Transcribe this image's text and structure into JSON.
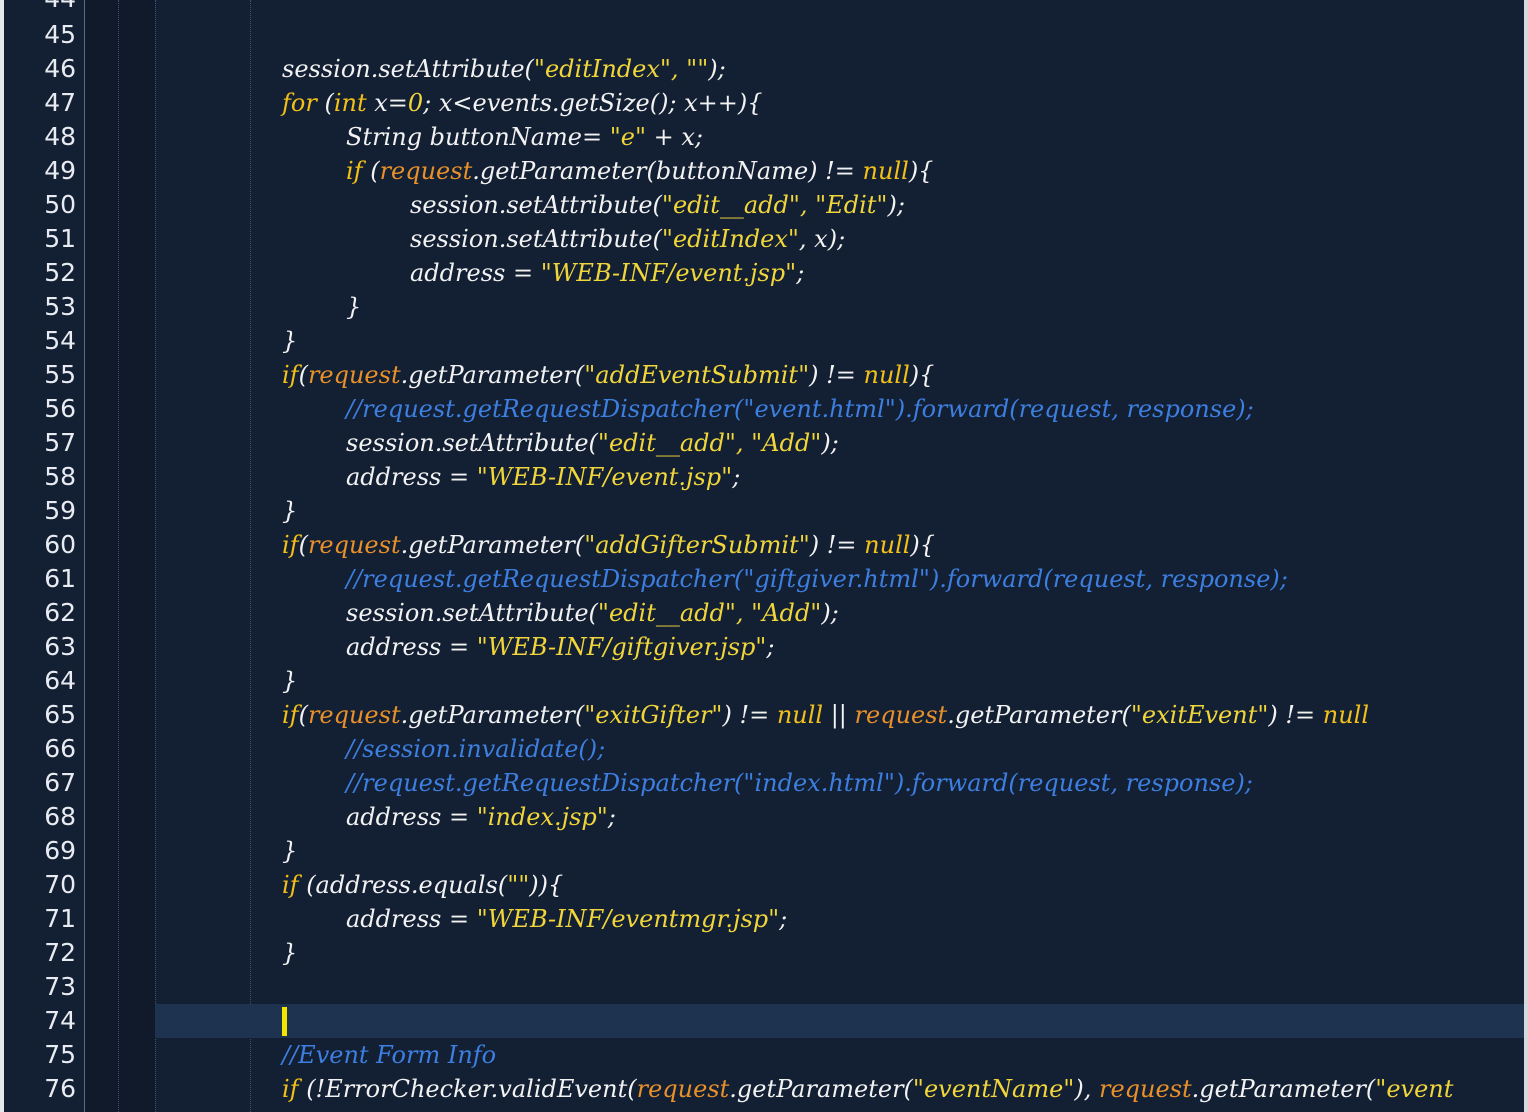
{
  "editor": {
    "cut_top_line": "44",
    "current_line": "74",
    "lines": [
      {
        "n": "45",
        "indent": 0,
        "segs": []
      },
      {
        "n": "46",
        "indent": 1,
        "segs": [
          {
            "t": "session.setAttribute(",
            "c": ""
          },
          {
            "t": "\"editIndex\", \"\"",
            "c": "str"
          },
          {
            "t": ");",
            "c": ""
          }
        ]
      },
      {
        "n": "47",
        "indent": 1,
        "segs": [
          {
            "t": "for",
            "c": "kw"
          },
          {
            "t": " (",
            "c": ""
          },
          {
            "t": "int",
            "c": "kw"
          },
          {
            "t": " x=",
            "c": ""
          },
          {
            "t": "0",
            "c": "str"
          },
          {
            "t": "; x<events.getSize(); x++){",
            "c": ""
          }
        ]
      },
      {
        "n": "48",
        "indent": 2,
        "segs": [
          {
            "t": "String buttonName= ",
            "c": ""
          },
          {
            "t": "\"e\"",
            "c": "str"
          },
          {
            "t": " + x;",
            "c": ""
          }
        ]
      },
      {
        "n": "49",
        "indent": 2,
        "segs": [
          {
            "t": "if",
            "c": "kw"
          },
          {
            "t": " (",
            "c": ""
          },
          {
            "t": "request",
            "c": "req"
          },
          {
            "t": ".getParameter(buttonName) != ",
            "c": ""
          },
          {
            "t": "null",
            "c": "kw"
          },
          {
            "t": "){",
            "c": ""
          }
        ]
      },
      {
        "n": "50",
        "indent": 3,
        "segs": [
          {
            "t": "session.setAttribute(",
            "c": ""
          },
          {
            "t": "\"edit__add\", \"Edit\"",
            "c": "str"
          },
          {
            "t": ");",
            "c": ""
          }
        ]
      },
      {
        "n": "51",
        "indent": 3,
        "segs": [
          {
            "t": "session.setAttribute(",
            "c": ""
          },
          {
            "t": "\"editIndex\"",
            "c": "str"
          },
          {
            "t": ", x);",
            "c": ""
          }
        ]
      },
      {
        "n": "52",
        "indent": 3,
        "segs": [
          {
            "t": "address = ",
            "c": ""
          },
          {
            "t": "\"WEB-INF/event.jsp\"",
            "c": "str"
          },
          {
            "t": ";",
            "c": ""
          }
        ]
      },
      {
        "n": "53",
        "indent": 2,
        "segs": [
          {
            "t": "}",
            "c": ""
          }
        ]
      },
      {
        "n": "54",
        "indent": 1,
        "segs": [
          {
            "t": "}",
            "c": ""
          }
        ]
      },
      {
        "n": "55",
        "indent": 1,
        "segs": [
          {
            "t": "if",
            "c": "kw"
          },
          {
            "t": "(",
            "c": ""
          },
          {
            "t": "request",
            "c": "req"
          },
          {
            "t": ".getParameter(",
            "c": ""
          },
          {
            "t": "\"addEventSubmit\"",
            "c": "str"
          },
          {
            "t": ") != ",
            "c": ""
          },
          {
            "t": "null",
            "c": "kw"
          },
          {
            "t": "){",
            "c": ""
          }
        ]
      },
      {
        "n": "56",
        "indent": 2,
        "segs": [
          {
            "t": "//request.getRequestDispatcher(\"event.html\").forward(request, response);",
            "c": "cmt"
          }
        ]
      },
      {
        "n": "57",
        "indent": 2,
        "segs": [
          {
            "t": "session.setAttribute(",
            "c": ""
          },
          {
            "t": "\"edit__add\", \"Add\"",
            "c": "str"
          },
          {
            "t": ");",
            "c": ""
          }
        ]
      },
      {
        "n": "58",
        "indent": 2,
        "segs": [
          {
            "t": "address = ",
            "c": ""
          },
          {
            "t": "\"WEB-INF/event.jsp\"",
            "c": "str"
          },
          {
            "t": ";",
            "c": ""
          }
        ]
      },
      {
        "n": "59",
        "indent": 1,
        "segs": [
          {
            "t": "}",
            "c": ""
          }
        ]
      },
      {
        "n": "60",
        "indent": 1,
        "segs": [
          {
            "t": "if",
            "c": "kw"
          },
          {
            "t": "(",
            "c": ""
          },
          {
            "t": "request",
            "c": "req"
          },
          {
            "t": ".getParameter(",
            "c": ""
          },
          {
            "t": "\"addGifterSubmit\"",
            "c": "str"
          },
          {
            "t": ") != ",
            "c": ""
          },
          {
            "t": "null",
            "c": "kw"
          },
          {
            "t": "){",
            "c": ""
          }
        ]
      },
      {
        "n": "61",
        "indent": 2,
        "segs": [
          {
            "t": "//request.getRequestDispatcher(\"giftgiver.html\").forward(request, response);",
            "c": "cmt"
          }
        ]
      },
      {
        "n": "62",
        "indent": 2,
        "segs": [
          {
            "t": "session.setAttribute(",
            "c": ""
          },
          {
            "t": "\"edit__add\", \"Add\"",
            "c": "str"
          },
          {
            "t": ");",
            "c": ""
          }
        ]
      },
      {
        "n": "63",
        "indent": 2,
        "segs": [
          {
            "t": "address = ",
            "c": ""
          },
          {
            "t": "\"WEB-INF/giftgiver.jsp\"",
            "c": "str"
          },
          {
            "t": ";",
            "c": ""
          }
        ]
      },
      {
        "n": "64",
        "indent": 1,
        "segs": [
          {
            "t": "}",
            "c": ""
          }
        ]
      },
      {
        "n": "65",
        "indent": 1,
        "segs": [
          {
            "t": "if",
            "c": "kw"
          },
          {
            "t": "(",
            "c": ""
          },
          {
            "t": "request",
            "c": "req"
          },
          {
            "t": ".getParameter(",
            "c": ""
          },
          {
            "t": "\"exitGifter\"",
            "c": "str"
          },
          {
            "t": ") != ",
            "c": ""
          },
          {
            "t": "null",
            "c": "kw"
          },
          {
            "t": " || ",
            "c": ""
          },
          {
            "t": "request",
            "c": "req"
          },
          {
            "t": ".getParameter(",
            "c": ""
          },
          {
            "t": "\"exitEvent\"",
            "c": "str"
          },
          {
            "t": ") != ",
            "c": ""
          },
          {
            "t": "null",
            "c": "kw"
          }
        ]
      },
      {
        "n": "66",
        "indent": 2,
        "segs": [
          {
            "t": "//session.invalidate();",
            "c": "cmt"
          }
        ]
      },
      {
        "n": "67",
        "indent": 2,
        "segs": [
          {
            "t": "//request.getRequestDispatcher(\"index.html\").forward(request, response);",
            "c": "cmt"
          }
        ]
      },
      {
        "n": "68",
        "indent": 2,
        "segs": [
          {
            "t": "address = ",
            "c": ""
          },
          {
            "t": "\"index.jsp\"",
            "c": "str"
          },
          {
            "t": ";",
            "c": ""
          }
        ]
      },
      {
        "n": "69",
        "indent": 1,
        "segs": [
          {
            "t": "}",
            "c": ""
          }
        ]
      },
      {
        "n": "70",
        "indent": 1,
        "segs": [
          {
            "t": "if",
            "c": "kw"
          },
          {
            "t": " (address.equals(",
            "c": ""
          },
          {
            "t": "\"\"",
            "c": "str"
          },
          {
            "t": ")){",
            "c": ""
          }
        ]
      },
      {
        "n": "71",
        "indent": 2,
        "segs": [
          {
            "t": "address = ",
            "c": ""
          },
          {
            "t": "\"WEB-INF/eventmgr.jsp\"",
            "c": "str"
          },
          {
            "t": ";",
            "c": ""
          }
        ]
      },
      {
        "n": "72",
        "indent": 1,
        "segs": [
          {
            "t": "}",
            "c": ""
          }
        ]
      },
      {
        "n": "73",
        "indent": 0,
        "segs": []
      },
      {
        "n": "74",
        "indent": 1,
        "segs": []
      },
      {
        "n": "75",
        "indent": 1,
        "segs": [
          {
            "t": "//Event Form Info",
            "c": "cmt"
          }
        ]
      },
      {
        "n": "76",
        "indent": 1,
        "segs": [
          {
            "t": "if",
            "c": "kw"
          },
          {
            "t": " (!ErrorChecker.validEvent(",
            "c": ""
          },
          {
            "t": "request",
            "c": "req"
          },
          {
            "t": ".getParameter(",
            "c": ""
          },
          {
            "t": "\"eventName\"",
            "c": "str"
          },
          {
            "t": "), ",
            "c": ""
          },
          {
            "t": "request",
            "c": "req"
          },
          {
            "t": ".getParameter(",
            "c": ""
          },
          {
            "t": "\"event",
            "c": "str"
          }
        ]
      }
    ]
  },
  "colors": {
    "background": "#131f33",
    "keyword": "#f2c018",
    "string": "#f0d63a",
    "request": "#e8902a",
    "comment": "#3d7fe0",
    "caret": "#f5e300"
  }
}
